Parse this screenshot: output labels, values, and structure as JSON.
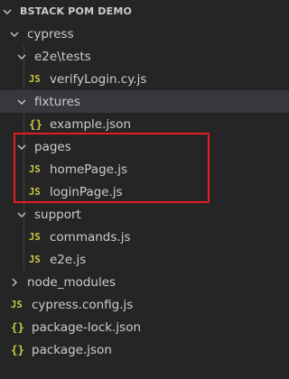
{
  "explorer": {
    "root": {
      "label": "BSTACK POM DEMO",
      "expanded": true
    },
    "items": [
      {
        "label": "cypress",
        "type": "folder",
        "expanded": true,
        "depth": 1
      },
      {
        "label": "e2e\\tests",
        "type": "folder",
        "expanded": true,
        "depth": 2
      },
      {
        "label": "verifyLogin.cy.js",
        "type": "js",
        "icon": "JS",
        "depth": 3
      },
      {
        "label": "fixtures",
        "type": "folder",
        "expanded": true,
        "depth": 2,
        "selected": true
      },
      {
        "label": "example.json",
        "type": "json",
        "icon": "{}",
        "depth": 3
      },
      {
        "label": "pages",
        "type": "folder",
        "expanded": true,
        "depth": 2
      },
      {
        "label": "homePage.js",
        "type": "js",
        "icon": "JS",
        "depth": 3
      },
      {
        "label": "loginPage.js",
        "type": "js",
        "icon": "JS",
        "depth": 3
      },
      {
        "label": "support",
        "type": "folder",
        "expanded": true,
        "depth": 2
      },
      {
        "label": "commands.js",
        "type": "js",
        "icon": "JS",
        "depth": 3
      },
      {
        "label": "e2e.js",
        "type": "js",
        "icon": "JS",
        "depth": 3
      },
      {
        "label": "node_modules",
        "type": "folder",
        "expanded": false,
        "depth": 1
      },
      {
        "label": "cypress.config.js",
        "type": "js",
        "icon": "JS",
        "depth": 1
      },
      {
        "label": "package-lock.json",
        "type": "json",
        "icon": "{}",
        "depth": 1
      },
      {
        "label": "package.json",
        "type": "json",
        "icon": "{}",
        "depth": 1
      }
    ]
  },
  "colors": {
    "background": "#252526",
    "selected_row": "#37373d",
    "text": "#cccccc",
    "js_icon": "#cbcb41",
    "json_icon": "#cbcb41",
    "highlight_border": "#e11e24"
  }
}
